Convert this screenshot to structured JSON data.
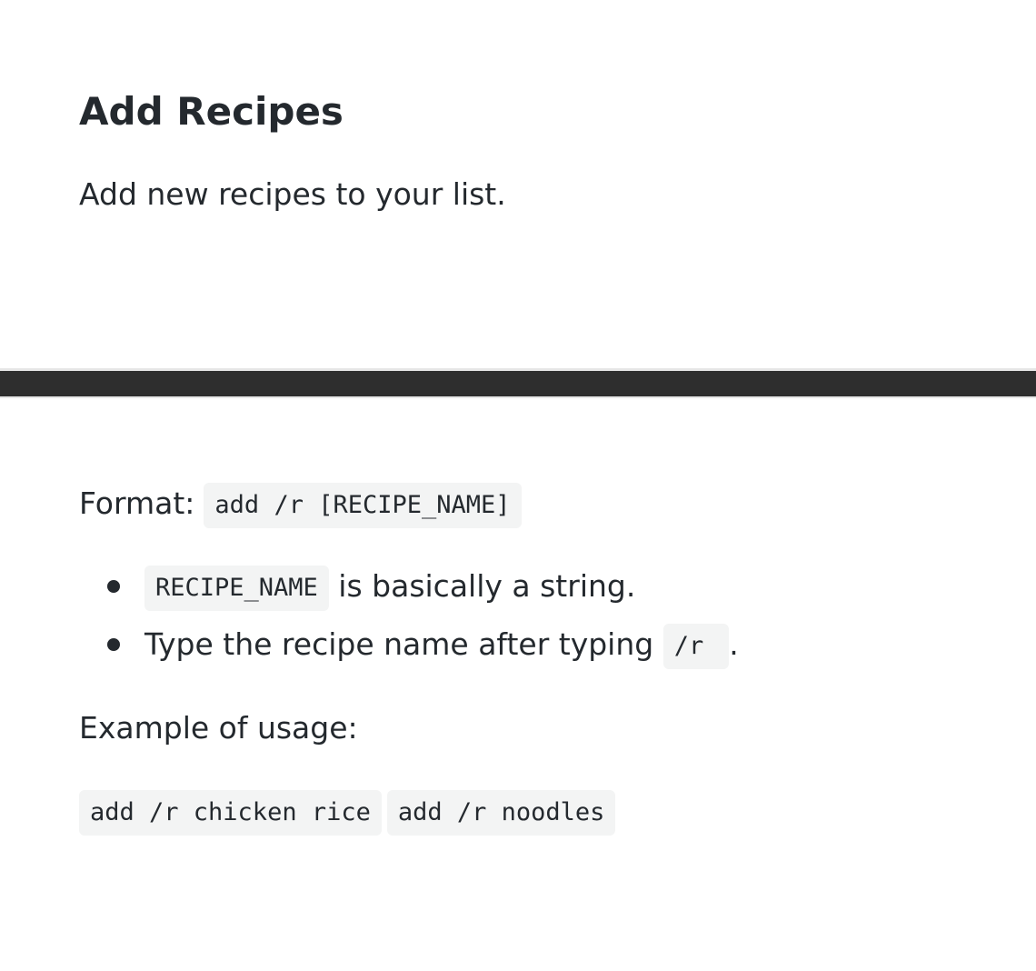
{
  "header": {
    "title": "Add Recipes",
    "description": "Add new recipes to your list."
  },
  "format": {
    "label": "Format:",
    "syntax": "add /r [RECIPE_NAME]"
  },
  "notes": [
    {
      "code": "RECIPE_NAME",
      "text": " is basically a string."
    },
    {
      "text": "Type the recipe name after typing ",
      "code": "/r",
      "suffix": "."
    }
  ],
  "example": {
    "label": "Example of usage:",
    "items": [
      "add /r chicken rice",
      "add /r noodles"
    ]
  }
}
